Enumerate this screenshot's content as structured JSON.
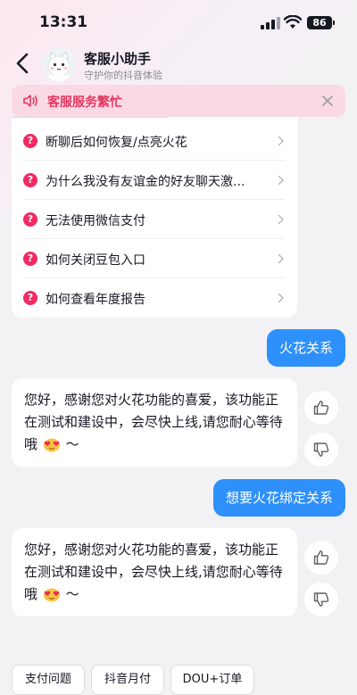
{
  "status": {
    "time": "13:31",
    "battery": "86"
  },
  "header": {
    "title": "客服小助手",
    "subtitle": "守护你的抖音体验"
  },
  "notice": {
    "text": "客服服务繁忙"
  },
  "faq": [
    {
      "label": "断聊后如何恢复/点亮火花"
    },
    {
      "label": "为什么我没有友谊金的好友聊天激..."
    },
    {
      "label": "无法使用微信支付"
    },
    {
      "label": "如何关闭豆包入口"
    },
    {
      "label": "如何查看年度报告"
    }
  ],
  "messages": [
    {
      "from": "user",
      "text": "火花关系"
    },
    {
      "from": "bot",
      "text": "您好，感谢您对火花功能的喜爱，该功能正在测试和建设中，会尽快上线,请您耐心等待哦",
      "tail": "～"
    },
    {
      "from": "user",
      "text": "想要火花绑定关系"
    },
    {
      "from": "bot",
      "text": "您好，感谢您对火花功能的喜爱，该功能正在测试和建设中，会尽快上线,请您耐心等待哦",
      "tail": "～"
    }
  ],
  "quick_actions": [
    {
      "label": "支付问题"
    },
    {
      "label": "抖音月付"
    },
    {
      "label": "DOU+订单"
    }
  ],
  "colors": {
    "accent": "#f22a63",
    "user_bubble": "#2e90fa",
    "notice_bg": "#fbd9e4"
  }
}
